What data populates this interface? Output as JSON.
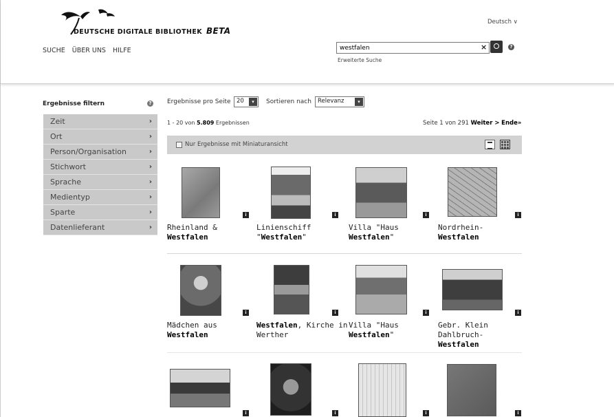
{
  "header": {
    "brand_name": "DEUTSCHE DIGITALE BIBLIOTHEK",
    "brand_badge": "BETA",
    "nav": [
      "SUCHE",
      "ÜBER UNS",
      "HILFE"
    ],
    "language": "Deutsch ∨",
    "search_value": "westfalen",
    "search_clear": "×",
    "help_glyph": "?",
    "advanced_search": "Erweiterte Suche"
  },
  "sidebar": {
    "title": "Ergebnisse filtern",
    "help_glyph": "?",
    "chevron": "›",
    "items": [
      "Zeit",
      "Ort",
      "Person/Organisation",
      "Stichwort",
      "Sprache",
      "Medientyp",
      "Sparte",
      "Datenlieferant"
    ]
  },
  "controls": {
    "per_page_label": "Ergebnisse pro Seite",
    "per_page_value": "20",
    "sort_label": "Sortieren nach",
    "sort_value": "Relevanz",
    "dropdown_glyph": "▾"
  },
  "summary": {
    "range": "1 - 20 von ",
    "total": "5.809",
    "suffix": " Ergebnissen",
    "page_text": "Seite 1 von 291",
    "next": "Weiter >",
    "last": "Ende»"
  },
  "toolbar": {
    "thumbnail_filter_label": "Nur Ergebnisse mit Miniaturansicht"
  },
  "info_glyph": "i",
  "results": [
    {
      "pre": "Rheinland & ",
      "hl": "Westfalen",
      "post": "",
      "picture": "map"
    },
    {
      "pre": "Linienschiff \"",
      "hl": "Westfalen",
      "post": "\"",
      "picture": "poster"
    },
    {
      "pre": "Villa \"Haus ",
      "hl": "Westfalen",
      "post": "\"",
      "picture": "villa"
    },
    {
      "pre": "Nordrhein-",
      "hl": "Westfalen",
      "post": "",
      "picture": "crack"
    },
    {
      "pre": "Mädchen aus ",
      "hl": "Westfalen",
      "post": "",
      "picture": "girl"
    },
    {
      "pre": "",
      "hl": "Westfalen",
      "post": ", Kirche in Werther",
      "picture": "church"
    },
    {
      "pre": "Villa \"Haus ",
      "hl": "Westfalen",
      "post": "\"",
      "picture": "villa2"
    },
    {
      "pre": "Gebr. Klein Dahlbruch-",
      "hl": "Westfalen",
      "post": "",
      "picture": "factory"
    },
    {
      "pre": "",
      "hl": "",
      "post": "",
      "picture": "land"
    },
    {
      "pre": "",
      "hl": "",
      "post": "",
      "picture": "dark"
    },
    {
      "pre": "",
      "hl": "",
      "post": "",
      "picture": "plan"
    },
    {
      "pre": "",
      "hl": "",
      "post": "",
      "picture": "gray"
    }
  ]
}
